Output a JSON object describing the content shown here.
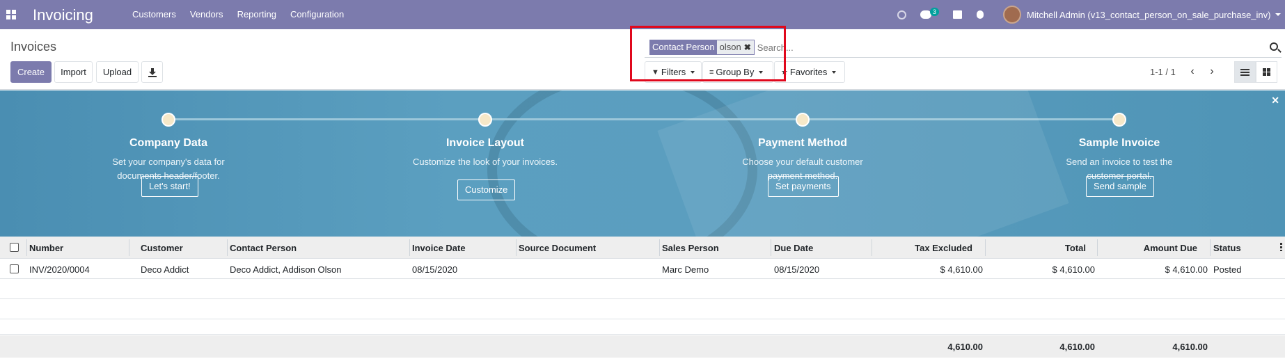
{
  "navbar": {
    "app_title": "Invoicing",
    "menu": [
      "Customers",
      "Vendors",
      "Reporting",
      "Configuration"
    ],
    "chat_count": "3",
    "user_name": "Mitchell Admin (v13_contact_person_on_sale_purchase_inv)",
    "bg_color": "#7c7bad"
  },
  "control_panel": {
    "breadcrumb": "Invoices",
    "buttons": {
      "create": "Create",
      "import": "Import",
      "upload": "Upload"
    },
    "search": {
      "facet_label": "Contact Person",
      "facet_value": "olson",
      "placeholder": "Search..."
    },
    "filters": {
      "filters": "Filters",
      "group_by": "Group By",
      "favorites": "Favorites"
    },
    "pager": "1-1 / 1"
  },
  "onboarding": {
    "steps": [
      {
        "title": "Company Data",
        "desc_line1": "Set your company's data for",
        "desc_line2": "documents header/footer.",
        "button": "Let's start!"
      },
      {
        "title": "Invoice Layout",
        "desc_line1": "Customize the look of your invoices.",
        "desc_line2": "",
        "button": "Customize"
      },
      {
        "title": "Payment Method",
        "desc_line1": "Choose your default customer",
        "desc_line2": "payment method.",
        "button": "Set payments"
      },
      {
        "title": "Sample Invoice",
        "desc_line1": "Send an invoice to test the",
        "desc_line2": "customer portal.",
        "button": "Send sample"
      }
    ]
  },
  "table": {
    "columns": [
      "Number",
      "Customer",
      "Contact Person",
      "Invoice Date",
      "Source Document",
      "Sales Person",
      "Due Date",
      "Tax Excluded",
      "Total",
      "Amount Due",
      "Status"
    ],
    "rows": [
      {
        "number": "INV/2020/0004",
        "customer": "Deco Addict",
        "contact_person": "Deco Addict, Addison Olson",
        "invoice_date": "08/15/2020",
        "source_document": "",
        "sales_person": "Marc Demo",
        "due_date": "08/15/2020",
        "tax_excluded": "$ 4,610.00",
        "total": "$ 4,610.00",
        "amount_due": "$ 4,610.00",
        "status": "Posted"
      }
    ],
    "totals": {
      "tax_excluded": "4,610.00",
      "total": "4,610.00",
      "amount_due": "4,610.00"
    }
  }
}
